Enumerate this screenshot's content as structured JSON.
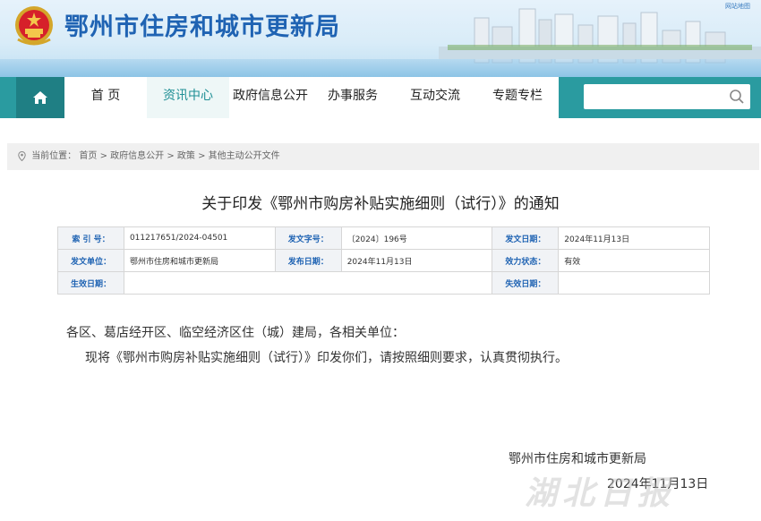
{
  "header": {
    "site_title": "鄂州市住房和城市更新局",
    "top_link": "网站地图"
  },
  "nav": {
    "items": [
      {
        "label": "首 页",
        "active": false
      },
      {
        "label": "资讯中心",
        "active": true
      },
      {
        "label": "政府信息公开",
        "active": false
      },
      {
        "label": "办事服务",
        "active": false
      },
      {
        "label": "互动交流",
        "active": false
      },
      {
        "label": "专题专栏",
        "active": false
      }
    ],
    "search_placeholder": ""
  },
  "breadcrumb": {
    "prefix": "当前位置：",
    "items": [
      "首页",
      "政府信息公开",
      "政策",
      "其他主动公开文件"
    ],
    "separator": ">"
  },
  "article": {
    "title": "关于印发《鄂州市购房补贴实施细则（试行）》的通知",
    "meta": {
      "index_label": "索 引 号：",
      "index_value": "011217651/2024-04501",
      "doc_no_label": "发文字号：",
      "doc_no_value": "〔2024〕196号",
      "issue_date_label": "发文日期：",
      "issue_date_value": "2024年11月13日",
      "issuer_label": "发文单位：",
      "issuer_value": "鄂州市住房和城市更新局",
      "publish_date_label": "发布日期：",
      "publish_date_value": "2024年11月13日",
      "status_label": "效力状态：",
      "status_value": "有效",
      "effective_label": "生效日期：",
      "effective_value": "",
      "expiry_label": "失效日期：",
      "expiry_value": ""
    },
    "salutation": "各区、葛店经开区、临空经济区住（城）建局，各相关单位：",
    "body": "现将《鄂州市购房补贴实施细则（试行）》印发你们，请按照细则要求，认真贯彻执行。",
    "signature": "鄂州市住房和城市更新局",
    "date": "2024年11月13日"
  },
  "watermark": "湖北日报",
  "colors": {
    "brand_blue": "#1f63b3",
    "nav_teal": "#2a9ba0",
    "nav_home": "#1f7f84"
  }
}
